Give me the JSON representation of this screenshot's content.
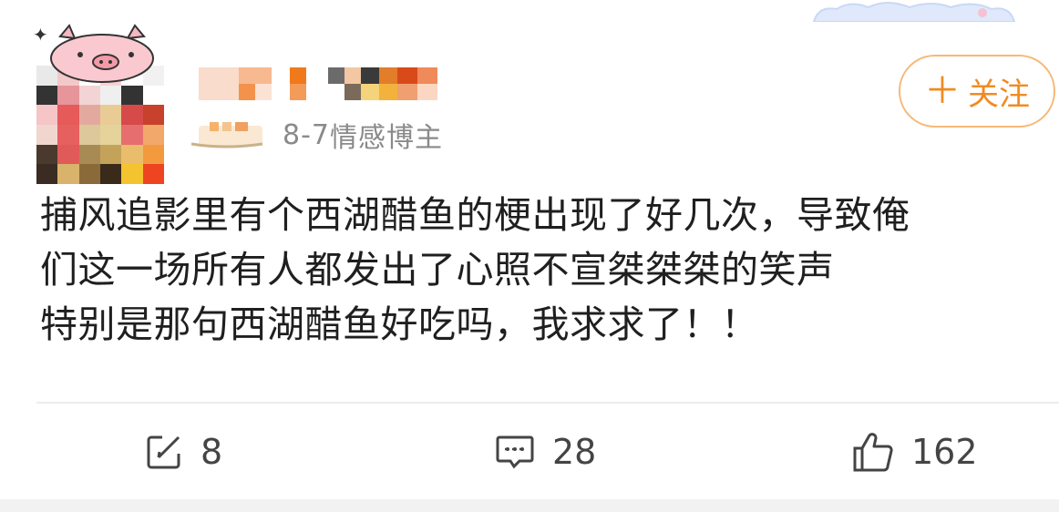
{
  "post": {
    "meta_date": "8-7",
    "meta_tag": "情感博主",
    "follow_label": "关注",
    "follow_plus": "＋",
    "text_lines": [
      "捕风追影里有个西湖醋鱼的梗出现了好几次，导致俺",
      "们这一场所有人都发出了心照不宣桀桀桀的笑声",
      "特别是那句西湖醋鱼好吃吗，我求求了！！"
    ]
  },
  "actions": {
    "repost_count": "8",
    "comment_count": "28",
    "like_count": "162"
  },
  "icons": {
    "repost": "edit-share-icon",
    "comment": "comment-bubble-icon",
    "like": "thumbs-up-icon"
  },
  "colors": {
    "accent": "#f08b22",
    "follow_border": "#f7b877",
    "meta": "#8a8a8a"
  }
}
